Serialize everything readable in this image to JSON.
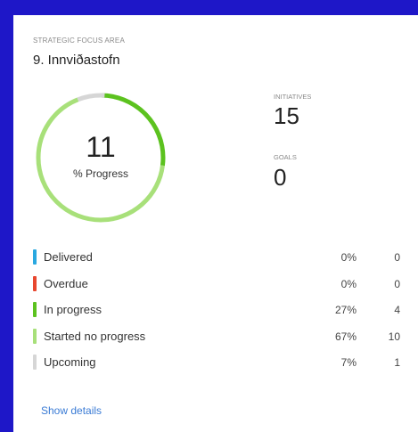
{
  "focus_area": {
    "eyebrow": "STRATEGIC FOCUS AREA",
    "title": "9. Innviðastofn"
  },
  "progress": {
    "value": "11",
    "label": "% Progress"
  },
  "stats": {
    "initiatives_label": "INITIATIVES",
    "initiatives_value": "15",
    "goals_label": "GOALS",
    "goals_value": "0"
  },
  "legend": [
    {
      "label": "Delivered",
      "pct": "0%",
      "count": "0",
      "color": "#29a8e0",
      "fraction": 0.0
    },
    {
      "label": "Overdue",
      "pct": "0%",
      "count": "0",
      "color": "#e8472f",
      "fraction": 0.0
    },
    {
      "label": "In progress",
      "pct": "27%",
      "count": "4",
      "color": "#5cc21f",
      "fraction": 0.27
    },
    {
      "label": "Started no progress",
      "pct": "67%",
      "count": "10",
      "color": "#a8e07a",
      "fraction": 0.67
    },
    {
      "label": "Upcoming",
      "pct": "7%",
      "count": "1",
      "color": "#d6d6d6",
      "fraction": 0.07
    }
  ],
  "actions": {
    "show_details": "Show details"
  }
}
